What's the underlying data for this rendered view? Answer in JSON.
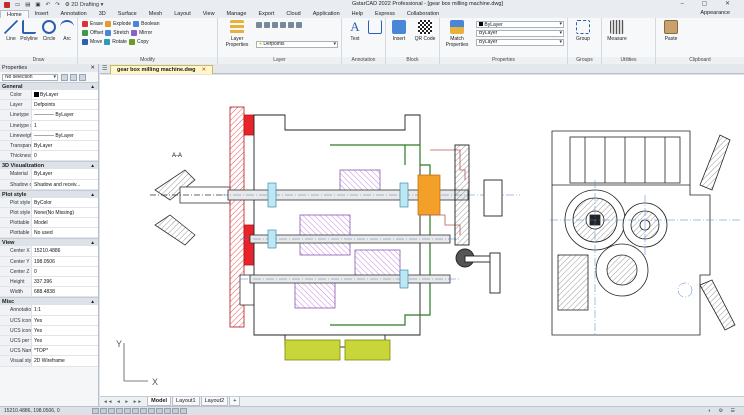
{
  "titlebar": {
    "workspace": "2D Drafting",
    "title": "GstarCAD 2022 Professional - [gear box milling machine.dwg]",
    "window_buttons": "–  ▢  ✕"
  },
  "ribbon_tabs": [
    "Home",
    "Insert",
    "Annotation",
    "3D",
    "Surface",
    "Mesh",
    "Layout",
    "View",
    "Manage",
    "Export",
    "Cloud",
    "Application",
    "Help",
    "Express",
    "Collaboration"
  ],
  "active_tab": "Home",
  "appearance_label": "Appearance",
  "ribbon": {
    "draw": {
      "title": "Draw",
      "line": "Line",
      "polyline": "Polyline",
      "circle": "Circle",
      "arc": "Arc"
    },
    "modify": {
      "title": "Modify",
      "rows": [
        [
          "Erase",
          "Explode",
          "Boolean"
        ],
        [
          "Offset",
          "Stretch",
          "Mirror"
        ],
        [
          "Move",
          "Rotate",
          "Copy"
        ]
      ]
    },
    "layer": {
      "title": "Layer",
      "layer_properties": "Layer Properties",
      "current_layer": "Defpoints"
    },
    "annotation": {
      "title": "Annotation",
      "text": "Text"
    },
    "block": {
      "title": "Block",
      "insert": "Insert",
      "qr_code": "QR Code"
    },
    "properties": {
      "title": "Properties",
      "match_properties": "Match Properties",
      "color": "ByLayer",
      "linetype": "ByLayer",
      "lineweight": "ByLayer"
    },
    "groups": {
      "title": "Groups",
      "group": "Group"
    },
    "utilities": {
      "title": "Utilities",
      "measure": "Measure"
    },
    "clipboard": {
      "title": "Clipboard",
      "paste": "Paste"
    }
  },
  "properties_panel": {
    "title": "Properties",
    "selection": "No selection",
    "sections": [
      {
        "name": "General",
        "rows": [
          {
            "key": "Color",
            "value": "ByLayer",
            "swatch": true
          },
          {
            "key": "Layer",
            "value": "Defpoints"
          },
          {
            "key": "Linetype",
            "value": "———— ByLayer"
          },
          {
            "key": "Linetype sc...",
            "value": "1"
          },
          {
            "key": "Lineweight",
            "value": "———— ByLayer"
          },
          {
            "key": "Transparen...",
            "value": "ByLayer"
          },
          {
            "key": "Thickness",
            "value": "0"
          }
        ]
      },
      {
        "name": "3D Visualization",
        "rows": [
          {
            "key": "Material",
            "value": "ByLayer"
          },
          {
            "key": "Shadow dis...",
            "value": "Shadow and receiv..."
          }
        ]
      },
      {
        "name": "Plot style",
        "rows": [
          {
            "key": "Plot style",
            "value": "ByColor"
          },
          {
            "key": "Plot style ta...",
            "value": "None(No Missing)"
          },
          {
            "key": "Plottable at...",
            "value": "Model"
          },
          {
            "key": "Plottable ty...",
            "value": "No used"
          }
        ]
      },
      {
        "name": "View",
        "rows": [
          {
            "key": "Center X",
            "value": "15210.4886"
          },
          {
            "key": "Center Y",
            "value": "198.0506"
          },
          {
            "key": "Center Z",
            "value": "0"
          },
          {
            "key": "Height",
            "value": "337.396"
          },
          {
            "key": "Width",
            "value": "688.4838"
          }
        ]
      },
      {
        "name": "Misc",
        "rows": [
          {
            "key": "Annotation...",
            "value": "1:1"
          },
          {
            "key": "UCS icon On",
            "value": "Yes"
          },
          {
            "key": "UCS icon at...",
            "value": "Yes"
          },
          {
            "key": "UCS per vi...",
            "value": "Yes"
          },
          {
            "key": "UCS Name",
            "value": "*TOP*"
          },
          {
            "key": "Visual styles",
            "value": "2D Wireframe"
          }
        ]
      }
    ]
  },
  "document_tab": "gear box milling machine.dwg",
  "drawing": {
    "section_label": "A-A",
    "axis_y": "Y",
    "axis_x": "X"
  },
  "layout_tabs": [
    "Model",
    "Layout1",
    "Layout2",
    "+"
  ],
  "active_layout": "Model",
  "statusbar": {
    "coords": "15210.4886, 198.0506, 0"
  },
  "colors": {
    "red": "#e8232b",
    "green": "#3fa535",
    "purple": "#b46cd8",
    "orange": "#f2a028",
    "pink": "#e8a0a0",
    "yellow_green": "#c8d63a",
    "cyan": "#3ab8d8"
  }
}
